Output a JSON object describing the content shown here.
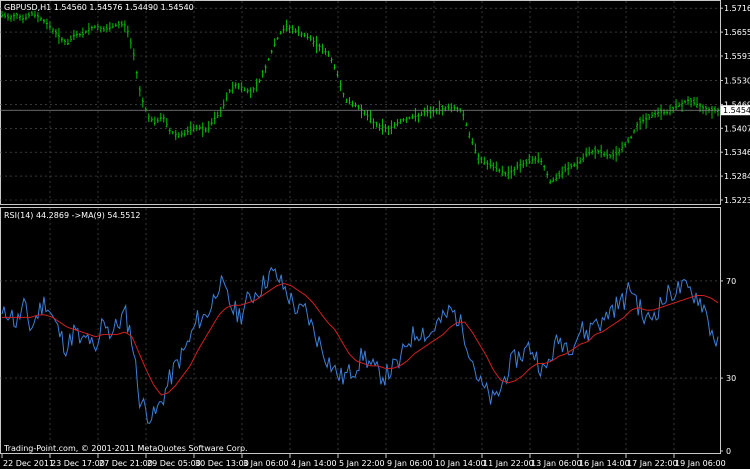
{
  "price_panel": {
    "title": "GBPUSD,H1  1.54560 1.54576 1.54490 1.54540",
    "current_price_label": "1.54540",
    "y_ticks": [
      "1.57165",
      "1.56550",
      "1.55935",
      "1.55305",
      "1.54690",
      "1.54075",
      "1.53460",
      "1.52845",
      "1.52230"
    ],
    "y_tick_values": [
      1.57165,
      1.5655,
      1.55935,
      1.55305,
      1.5469,
      1.54075,
      1.5346,
      1.52845,
      1.5223
    ],
    "current_price": 1.5454,
    "bar_color": "#00c000"
  },
  "rsi_panel": {
    "title": "RSI(14) 44.2869   ->MA(9) 54.5512",
    "y_ticks": [
      "70",
      "30",
      "0"
    ],
    "y_tick_values": [
      70,
      30,
      0
    ],
    "rsi_color": "#3d7fd8",
    "ma_color": "#d02020"
  },
  "x_axis": {
    "labels": [
      "22 Dec 2011",
      "23 Dec 17:00",
      "27 Dec 21:00",
      "29 Dec 05:00",
      "30 Dec 13:00",
      "3 Jan 06:00",
      "4 Jan 14:00",
      "5 Jan 22:00",
      "9 Jan 06:00",
      "10 Jan 14:00",
      "11 Jan 22:00",
      "13 Jan 06:00",
      "16 Jan 14:00",
      "17 Jan 22:00",
      "19 Jan 06:00"
    ]
  },
  "copyright": "Trading-Point.com, © 2001-2011 MetaQuotes Software Corp.",
  "chart_data": {
    "type": "line",
    "title": "GBPUSD,H1",
    "series": [
      {
        "name": "GBPUSD",
        "values": [
          1.5698,
          1.5692,
          1.57,
          1.5688,
          1.5702,
          1.5695,
          1.568,
          1.566,
          1.564,
          1.5625,
          1.565,
          1.5648,
          1.5665,
          1.567,
          1.566,
          1.5668,
          1.5675,
          1.5672,
          1.56,
          1.549,
          1.544,
          1.542,
          1.544,
          1.54,
          1.539,
          1.5395,
          1.5405,
          1.541,
          1.54,
          1.543,
          1.545,
          1.55,
          1.552,
          1.551,
          1.55,
          1.552,
          1.556,
          1.561,
          1.565,
          1.567,
          1.566,
          1.565,
          1.564,
          1.5625,
          1.561,
          1.559,
          1.554,
          1.548,
          1.547,
          1.546,
          1.544,
          1.542,
          1.541,
          1.5405,
          1.542,
          1.543,
          1.5435,
          1.544,
          1.5448,
          1.545,
          1.5455,
          1.5462,
          1.546,
          1.5452,
          1.539,
          1.534,
          1.532,
          1.531,
          1.53,
          1.529,
          1.53,
          1.5315,
          1.532,
          1.533,
          1.532,
          1.527,
          1.528,
          1.53,
          1.531,
          1.532,
          1.534,
          1.535,
          1.5345,
          1.5335,
          1.534,
          1.536,
          1.538,
          1.542,
          1.543,
          1.544,
          1.545,
          1.5448,
          1.546,
          1.547,
          1.548,
          1.547,
          1.546,
          1.5455,
          1.5454
        ]
      },
      {
        "name": "RSI(14)",
        "values": [
          55,
          58,
          52,
          60,
          50,
          57,
          62,
          55,
          48,
          42,
          50,
          44,
          47,
          38,
          56,
          48,
          52,
          57,
          46,
          22,
          16,
          14,
          20,
          28,
          35,
          40,
          46,
          54,
          55,
          60,
          70,
          64,
          58,
          56,
          62,
          65,
          68,
          73,
          72,
          67,
          62,
          57,
          58,
          50,
          44,
          38,
          33,
          30,
          32,
          35,
          40,
          35,
          32,
          31,
          34,
          36,
          45,
          48,
          50,
          47,
          52,
          54,
          58,
          55,
          48,
          38,
          28,
          24,
          20,
          26,
          34,
          38,
          40,
          43,
          38,
          32,
          40,
          46,
          44,
          44,
          50,
          48,
          55,
          52,
          58,
          60,
          62,
          68,
          60,
          53,
          56,
          60,
          64,
          66,
          67,
          66,
          64,
          60,
          50,
          44
        ]
      },
      {
        "name": "MA(9)",
        "values": [
          55,
          55,
          55,
          55,
          55,
          56,
          56,
          55,
          53,
          51,
          50,
          49,
          48,
          47,
          48,
          48,
          48,
          49,
          47,
          40,
          33,
          27,
          23,
          24,
          27,
          31,
          35,
          41,
          46,
          51,
          56,
          59,
          60,
          60,
          61,
          62,
          64,
          66,
          68,
          69,
          68,
          66,
          64,
          61,
          57,
          53,
          50,
          45,
          40,
          37,
          36,
          35,
          35,
          34,
          34,
          35,
          37,
          40,
          42,
          44,
          46,
          48,
          51,
          53,
          53,
          49,
          44,
          39,
          33,
          29,
          28,
          29,
          31,
          34,
          36,
          36,
          37,
          39,
          40,
          42,
          44,
          45,
          48,
          49,
          51,
          53,
          55,
          58,
          59,
          58,
          58,
          59,
          60,
          61,
          62,
          63,
          64,
          64,
          63,
          61
        ]
      }
    ],
    "ylim_price": [
      1.5223,
      1.5717
    ],
    "ylim_rsi": [
      0,
      100
    ],
    "rsi_levels": [
      70,
      30
    ],
    "grid": true
  }
}
